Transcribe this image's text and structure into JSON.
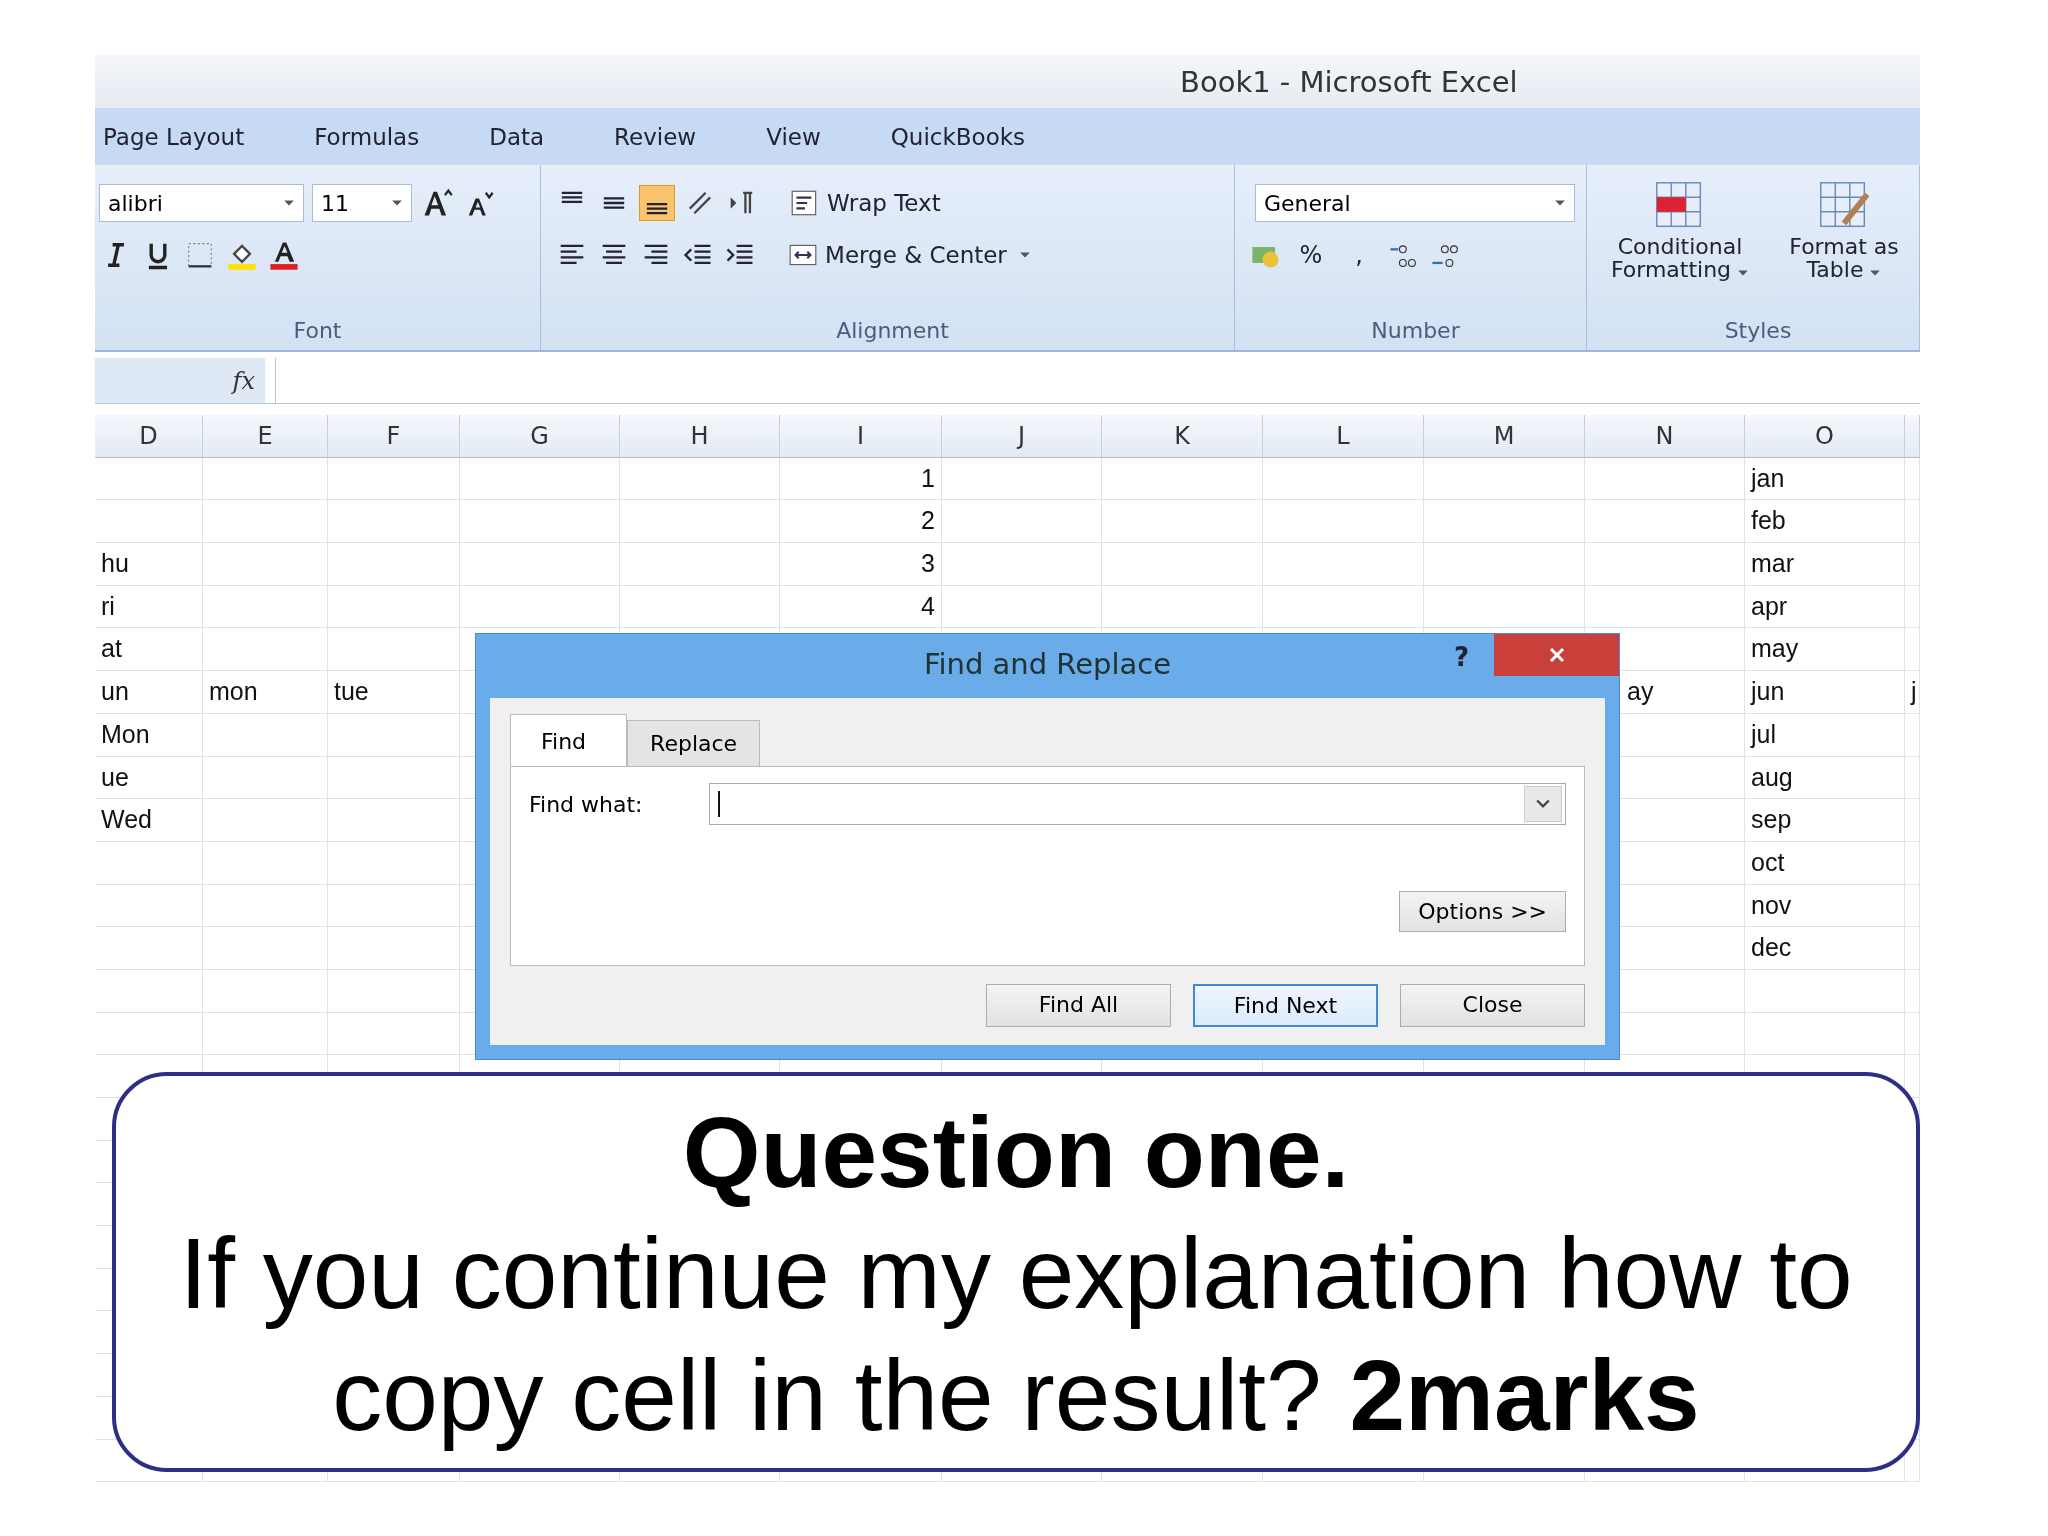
{
  "window": {
    "title": "Book1 - Microsoft Excel"
  },
  "ribbon_tabs": [
    "Page Layout",
    "Formulas",
    "Data",
    "Review",
    "View",
    "QuickBooks"
  ],
  "ribbon": {
    "font": {
      "name": "alibri",
      "size": "11",
      "label": "Font"
    },
    "alignment": {
      "label": "Alignment",
      "vertical_align": [
        {
          "selected": false
        },
        {
          "selected": false
        },
        {
          "selected": true
        }
      ],
      "wrap_text": "Wrap Text",
      "merge": "Merge & Center"
    },
    "number": {
      "format": "General",
      "percent": "%",
      "comma": ",",
      "label": "Number"
    },
    "styles": {
      "items": [
        "Conditional Formatting",
        "Format as Table"
      ],
      "label": "Styles"
    }
  },
  "formula_bar": {
    "fx": "fx"
  },
  "sheet": {
    "columns": [
      {
        "label": "D",
        "kind": "text"
      },
      {
        "label": "E",
        "kind": "text"
      },
      {
        "label": "F",
        "kind": "text"
      },
      {
        "label": "G",
        "kind": "text"
      },
      {
        "label": "H",
        "kind": "text"
      },
      {
        "label": "I",
        "kind": "number"
      },
      {
        "label": "J",
        "kind": "text"
      },
      {
        "label": "K",
        "kind": "text"
      },
      {
        "label": "L",
        "kind": "text"
      },
      {
        "label": "M",
        "kind": "text"
      },
      {
        "label": "N",
        "kind": "text"
      },
      {
        "label": "O",
        "kind": "text"
      }
    ],
    "rows": [
      [
        "",
        "",
        "",
        "",
        "",
        "1",
        "",
        "",
        "",
        "",
        "",
        "jan",
        ""
      ],
      [
        "",
        "",
        "",
        "",
        "",
        "2",
        "",
        "",
        "",
        "",
        "",
        "feb",
        ""
      ],
      [
        "hu",
        "",
        "",
        "",
        "",
        "3",
        "",
        "",
        "",
        "",
        "",
        "mar",
        ""
      ],
      [
        "ri",
        "",
        "",
        "",
        "",
        "4",
        "",
        "",
        "",
        "",
        "",
        "apr",
        ""
      ],
      [
        "at",
        "",
        "",
        "",
        "",
        "",
        "",
        "",
        "",
        "",
        "",
        "may",
        ""
      ],
      [
        "un",
        "mon",
        "tue",
        "",
        "",
        "",
        "",
        "",
        "",
        "",
        "ay",
        "jun",
        "j"
      ],
      [
        "Mon",
        "",
        "",
        "",
        "",
        "",
        "",
        "",
        "",
        "",
        "",
        "jul",
        ""
      ],
      [
        "ue",
        "",
        "",
        "",
        "",
        "",
        "",
        "",
        "",
        "",
        "",
        "aug",
        ""
      ],
      [
        "Wed",
        "",
        "",
        "",
        "",
        "",
        "",
        "",
        "",
        "",
        "",
        "sep",
        ""
      ],
      [
        "",
        "",
        "",
        "",
        "",
        "",
        "",
        "",
        "",
        "",
        "",
        "oct",
        ""
      ],
      [
        "",
        "",
        "",
        "",
        "",
        "",
        "",
        "",
        "",
        "",
        "",
        "nov",
        ""
      ],
      [
        "",
        "",
        "",
        "",
        "",
        "",
        "",
        "",
        "",
        "",
        "",
        "dec",
        ""
      ]
    ]
  },
  "dialog": {
    "title": "Find and Replace",
    "help": "?",
    "tabs": [
      {
        "label": "Find",
        "selected": true
      },
      {
        "label": "Replace",
        "selected": false
      }
    ],
    "find_label": "Find what:",
    "options": "Options >>",
    "buttons": [
      {
        "label": "Find All",
        "focused": false
      },
      {
        "label": "Find Next",
        "focused": true
      },
      {
        "label": "Close",
        "focused": false
      }
    ]
  },
  "question": {
    "title": "Question one.",
    "text": "If you continue my explanation how to copy cell in the result? **2marks**"
  }
}
